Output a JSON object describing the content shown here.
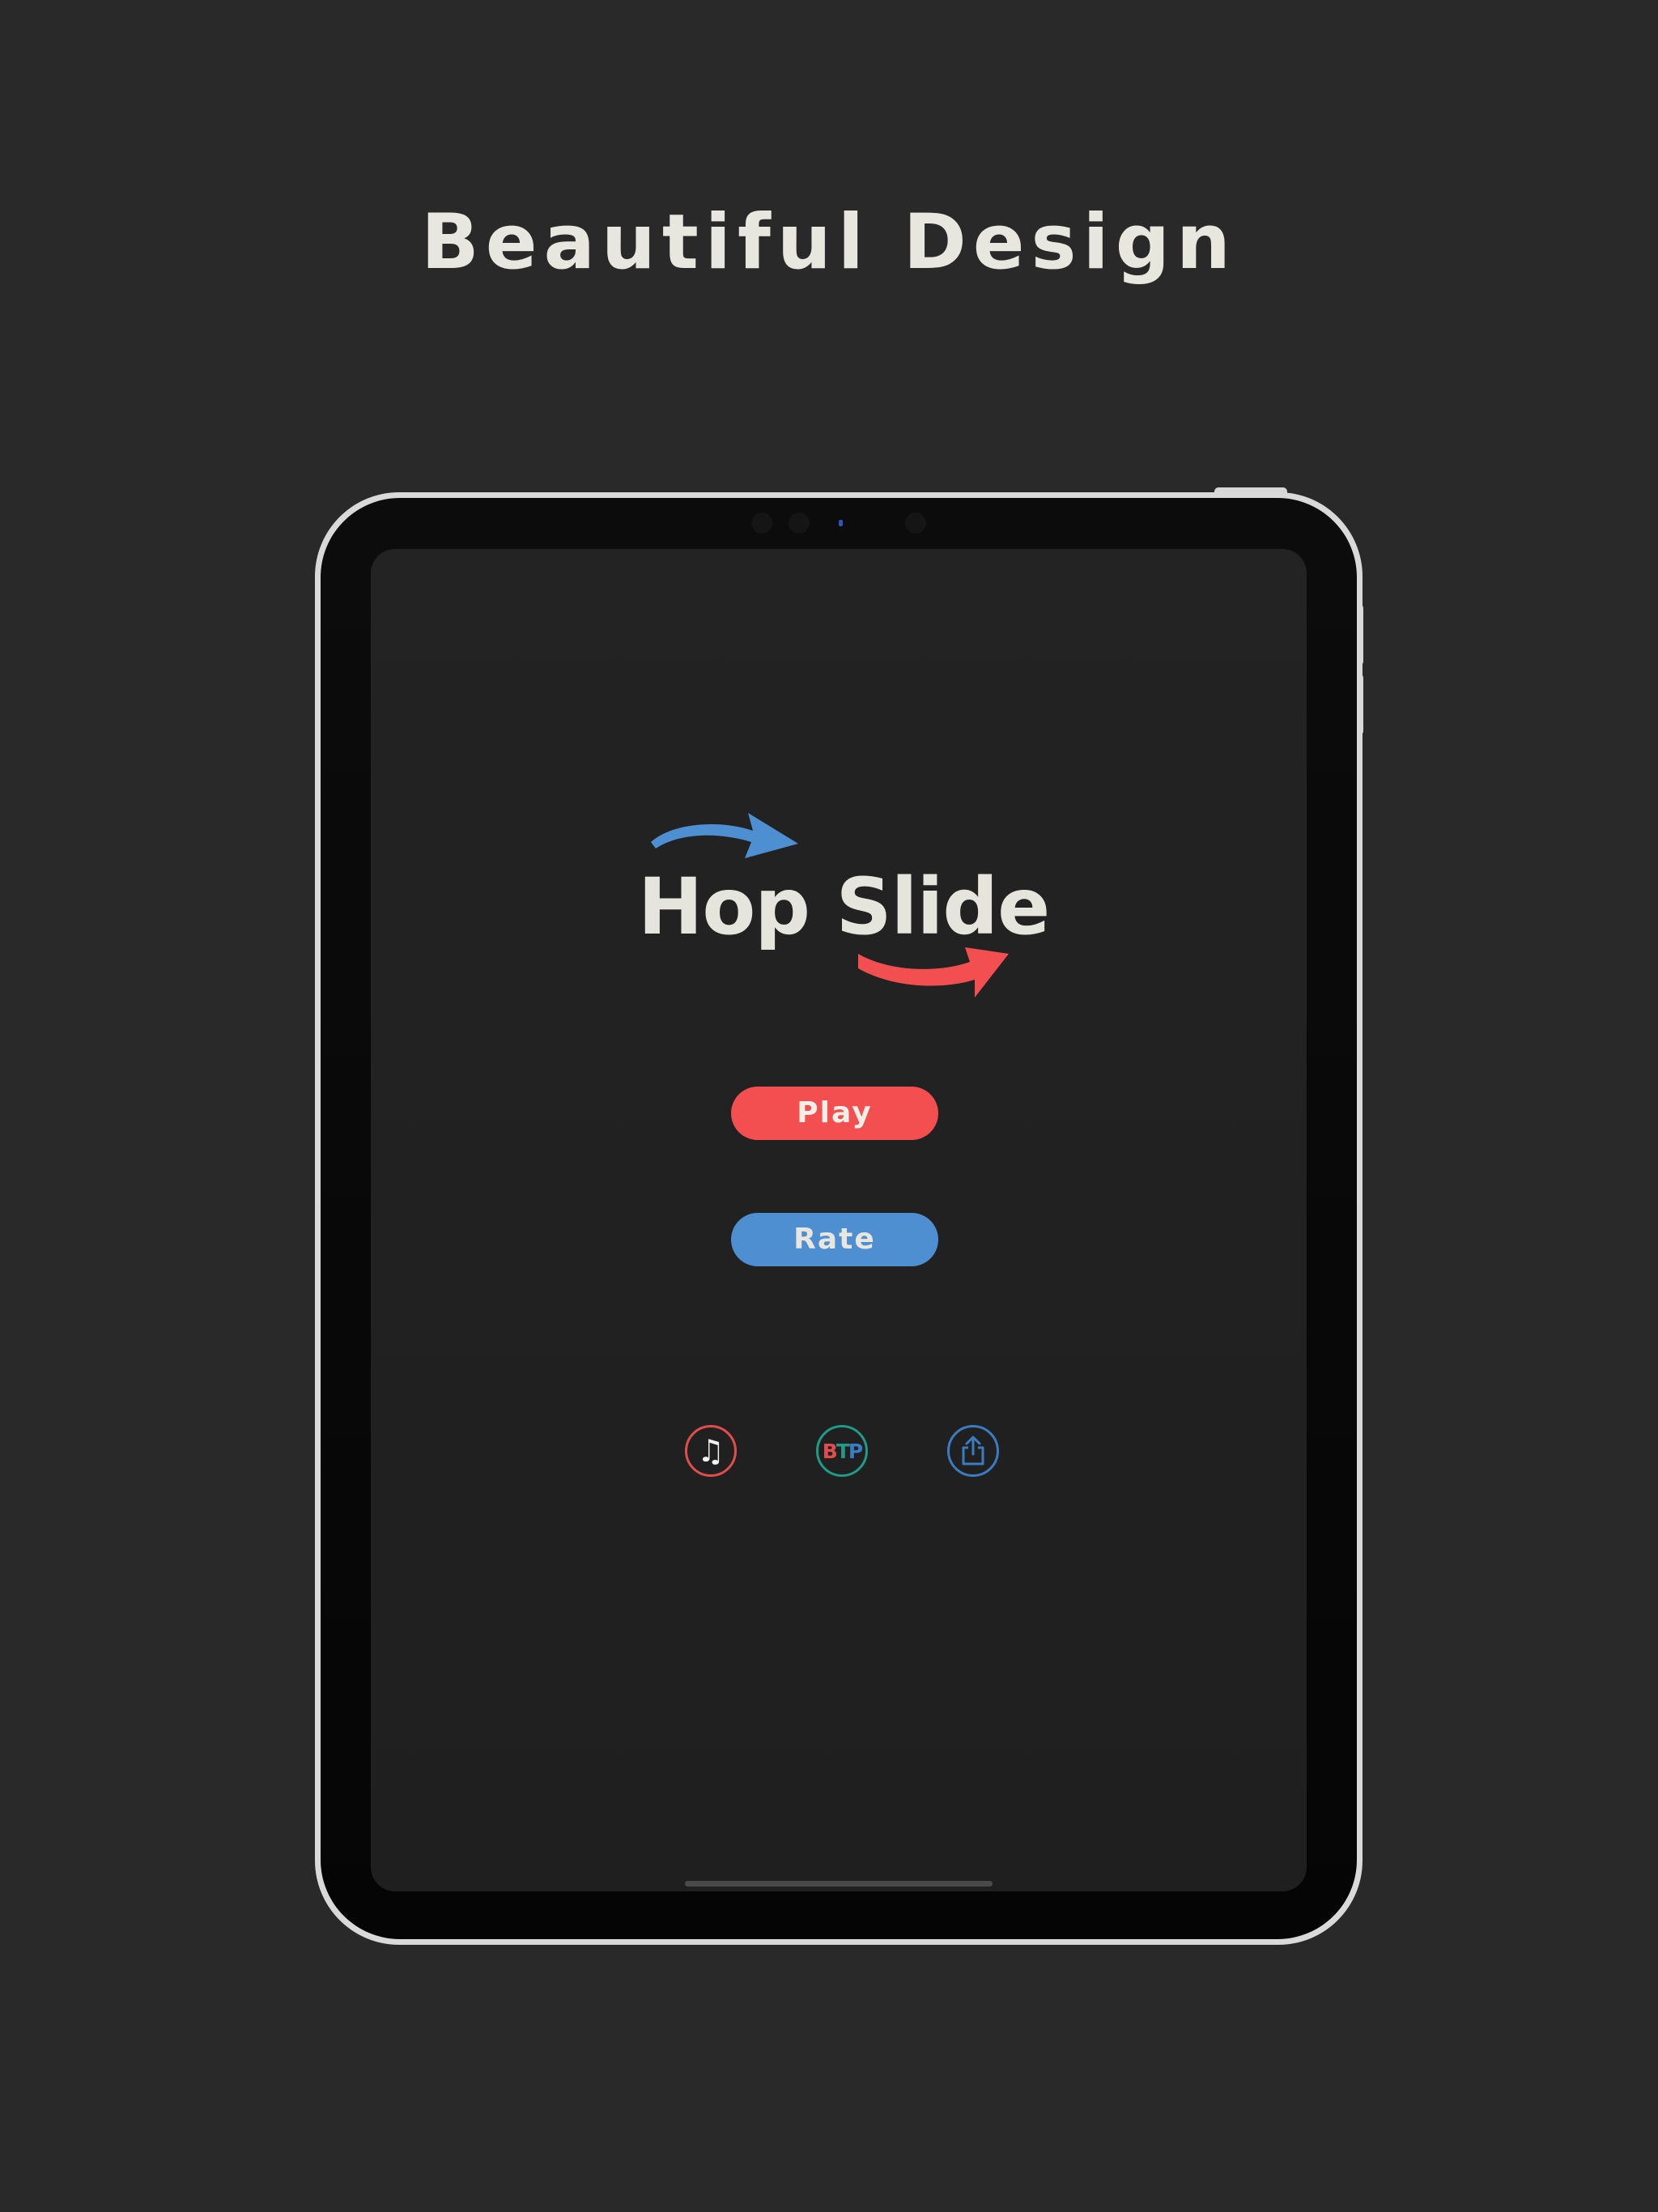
{
  "headline": "Beautiful Design",
  "app": {
    "title": "Hop Slide",
    "buttons": {
      "play_label": "Play",
      "rate_label": "Rate"
    },
    "icon_buttons": [
      {
        "icon": "music-note-icon",
        "color": "#e04d4d"
      },
      {
        "icon": "btp-logo-icon",
        "text": "BTP",
        "color": "#1f9a85"
      },
      {
        "icon": "share-icon",
        "color": "#3a7cc1"
      }
    ]
  },
  "colors": {
    "background": "#292929",
    "screen": "#212121",
    "accent_red": "#f34f50",
    "accent_blue": "#4d8fd1",
    "text_light": "#e7e6df"
  }
}
